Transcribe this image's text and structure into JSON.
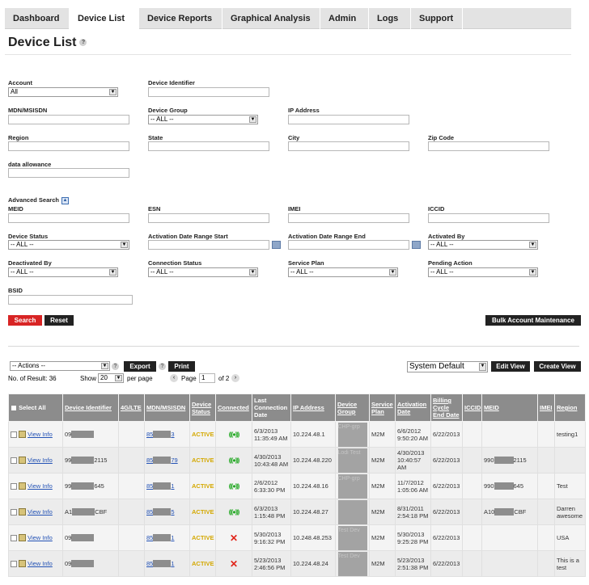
{
  "nav": {
    "tabs": [
      "Dashboard",
      "Device List",
      "Device Reports",
      "Graphical Analysis",
      "Admin",
      "Logs",
      "Support"
    ]
  },
  "page": {
    "title": "Device List",
    "help": "?"
  },
  "search": {
    "account_label": "Account",
    "account_value": "All",
    "device_identifier_label": "Device Identifier",
    "mdn_label": "MDN/MSISDN",
    "device_group_label": "Device Group",
    "device_group_value": "-- ALL --",
    "ip_label": "IP Address",
    "region_label": "Region",
    "state_label": "State",
    "city_label": "City",
    "zip_label": "Zip Code",
    "data_allowance_label": "data allowance",
    "advanced_label": "Advanced Search",
    "meid_label": "MEID",
    "esn_label": "ESN",
    "imei_label": "IMEI",
    "iccid_label": "ICCID",
    "device_status_label": "Device Status",
    "device_status_value": "-- ALL --",
    "act_start_label": "Activation Date Range Start",
    "act_end_label": "Activation Date Range End",
    "activated_by_label": "Activated By",
    "activated_by_value": "-- ALL --",
    "deactivated_by_label": "Deactivated By",
    "deactivated_by_value": "-- ALL --",
    "conn_status_label": "Connection Status",
    "conn_status_value": "-- ALL --",
    "service_plan_label": "Service Plan",
    "service_plan_value": "-- ALL --",
    "pending_action_label": "Pending Action",
    "pending_action_value": "-- ALL --",
    "bsid_label": "BSID",
    "search_button": "Search",
    "reset_button": "Reset",
    "bulk_button": "Bulk Account Maintenance"
  },
  "toolbar": {
    "actions_value": "-- Actions --",
    "export_button": "Export",
    "print_button": "Print",
    "help": "?",
    "results_text": "No. of Result: 36",
    "show_label": "Show",
    "show_value": "20",
    "per_page": "per page",
    "page_label": "Page",
    "page_value": "1",
    "of_pages": "of 2",
    "view_value": "System Default",
    "edit_view_button": "Edit View",
    "create_view_button": "Create View"
  },
  "table": {
    "columns": [
      "Select All",
      "Device Identifier",
      "4G/LTE",
      "MDN/MSISDN",
      "Device Status",
      "Connected",
      "Last Connection Date",
      "IP Address",
      "Device Group",
      "Service Plan",
      "Activation Date",
      "Billing Cycle End Date",
      "ICCID",
      "MEID",
      "IMEI",
      "Region"
    ],
    "view_info": "View Info",
    "rows": [
      {
        "id_pre": "09",
        "id_post": "",
        "mdn_pre": "85",
        "mdn_post": "3",
        "status": "ACTIVE",
        "connected": true,
        "last": "6/3/2013 11:35:49 AM",
        "ip": "10.224.48.1",
        "group_text": "CHP-grp",
        "plan": "M2M",
        "act": "6/6/2012 9:50:20 AM",
        "billing": "6/22/2013",
        "meid_pre": "",
        "meid_post": "",
        "region": "testing1"
      },
      {
        "id_pre": "99",
        "id_post": "2115",
        "mdn_pre": "85",
        "mdn_post": "79",
        "status": "ACTIVE",
        "connected": true,
        "last": "4/30/2013 10:43:48 AM",
        "ip": "10.224.48.220",
        "group_text": "Lodi Test",
        "plan": "M2M",
        "act": "4/30/2013 10:40:57 AM",
        "billing": "6/22/2013",
        "meid_pre": "990",
        "meid_post": "2115",
        "region": ""
      },
      {
        "id_pre": "99",
        "id_post": "645",
        "mdn_pre": "85",
        "mdn_post": "1",
        "status": "ACTIVE",
        "connected": true,
        "last": "2/6/2012 6:33:30 PM",
        "ip": "10.224.48.16",
        "group_text": "CHP-grp",
        "plan": "M2M",
        "act": "11/7/2012 1:05:06 AM",
        "billing": "6/22/2013",
        "meid_pre": "990",
        "meid_post": "645",
        "region": "Test"
      },
      {
        "id_pre": "A1",
        "id_post": "CBF",
        "mdn_pre": "85",
        "mdn_post": "5",
        "status": "ACTIVE",
        "connected": true,
        "last": "6/3/2013 1:15:48 PM",
        "ip": "10.224.48.27",
        "group_text": "",
        "plan": "M2M",
        "act": "8/31/2011 2:54:18 PM",
        "billing": "6/22/2013",
        "meid_pre": "A10",
        "meid_post": "CBF",
        "region": "Darren awesome"
      },
      {
        "id_pre": "09",
        "id_post": "",
        "mdn_pre": "85",
        "mdn_post": "1",
        "status": "ACTIVE",
        "connected": false,
        "last": "5/30/2013 9:16:32 PM",
        "ip": "10.248.48.253",
        "group_text": "Test Dev",
        "plan": "M2M",
        "act": "5/30/2013 9:25:28 PM",
        "billing": "6/22/2013",
        "meid_pre": "",
        "meid_post": "",
        "region": "USA"
      },
      {
        "id_pre": "09",
        "id_post": "",
        "mdn_pre": "85",
        "mdn_post": "1",
        "status": "ACTIVE",
        "connected": false,
        "last": "5/23/2013 2:46:56 PM",
        "ip": "10.224.48.24",
        "group_text": "Test Dev",
        "plan": "M2M",
        "act": "5/23/2013 2:51:38 PM",
        "billing": "6/22/2013",
        "meid_pre": "",
        "meid_post": "",
        "region": "This is a test"
      }
    ]
  },
  "colors": {
    "accent_red": "#d82424",
    "header_gray": "#8c8c8c",
    "link_blue": "#2352b5",
    "active_yellow": "#d4a800",
    "connected_green": "#23a823",
    "disconnected_red": "#e0241a"
  }
}
